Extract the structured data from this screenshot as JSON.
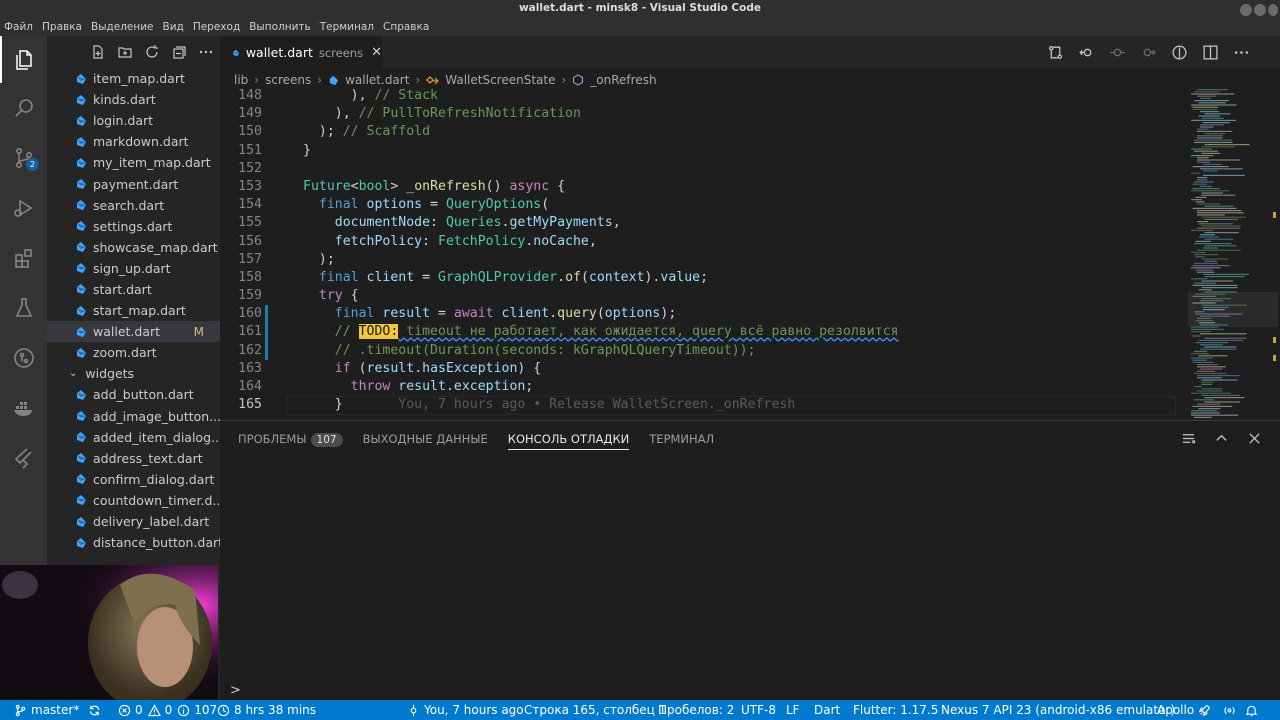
{
  "window": {
    "title": "wallet.dart - minsk8 - Visual Studio Code"
  },
  "menu": [
    "Файл",
    "Правка",
    "Выделение",
    "Вид",
    "Переход",
    "Выполнить",
    "Терминал",
    "Справка"
  ],
  "activity_bar": {
    "source_control_badge": "2"
  },
  "explorer": {
    "files_top": [
      {
        "name": "item_map.dart"
      },
      {
        "name": "kinds.dart"
      },
      {
        "name": "login.dart"
      },
      {
        "name": "markdown.dart"
      },
      {
        "name": "my_item_map.dart"
      },
      {
        "name": "payment.dart"
      },
      {
        "name": "search.dart"
      },
      {
        "name": "settings.dart"
      },
      {
        "name": "showcase_map.dart"
      },
      {
        "name": "sign_up.dart"
      },
      {
        "name": "start.dart"
      },
      {
        "name": "start_map.dart"
      },
      {
        "name": "wallet.dart",
        "selected": true,
        "status": "M"
      },
      {
        "name": "zoom.dart"
      }
    ],
    "folder": "widgets",
    "files_widgets": [
      {
        "name": "add_button.dart"
      },
      {
        "name": "add_image_button...."
      },
      {
        "name": "added_item_dialog...."
      },
      {
        "name": "address_text.dart"
      },
      {
        "name": "confirm_dialog.dart"
      },
      {
        "name": "countdown_timer.d..."
      },
      {
        "name": "delivery_label.dart"
      },
      {
        "name": "distance_button.dart"
      }
    ]
  },
  "editor": {
    "tab": {
      "name": "wallet.dart",
      "description": "screens"
    },
    "breadcrumbs": [
      "lib",
      "screens",
      "wallet.dart",
      "WalletScreenState",
      "_onRefresh"
    ],
    "lines": [
      {
        "n": "148",
        "html": "      ), <span class=\"cm\">// Stack</span>"
      },
      {
        "n": "149",
        "html": "    ), <span class=\"cm\">// PullToRefreshNotification</span>"
      },
      {
        "n": "150",
        "html": "  ); <span class=\"cm\">// Scaffold</span>"
      },
      {
        "n": "151",
        "html": "}"
      },
      {
        "n": "152",
        "html": ""
      },
      {
        "n": "153",
        "html": "<span class=\"ty\">Future</span>&lt;<span class=\"ty\">bool</span>&gt; <span class=\"fn\">_onRefresh</span>() <span class=\"kw2\">async</span> {"
      },
      {
        "n": "154",
        "html": "  <span class=\"kw\">final</span> <span class=\"var\">options</span> = <span class=\"ty\">QueryOptions</span>("
      },
      {
        "n": "155",
        "html": "    <span class=\"var\">documentNode</span>: <span class=\"ty\">Queries</span>.<span class=\"var\">getMyPayments</span>,"
      },
      {
        "n": "156",
        "html": "    <span class=\"var\">fetchPolicy</span>: <span class=\"ty\">FetchPolicy</span>.<span class=\"var\">noCache</span>,"
      },
      {
        "n": "157",
        "html": "  );"
      },
      {
        "n": "158",
        "html": "  <span class=\"kw\">final</span> <span class=\"var\">client</span> = <span class=\"ty\">GraphQLProvider</span>.<span class=\"fn\">of</span>(<span class=\"var\">context</span>).<span class=\"var\">value</span>;"
      },
      {
        "n": "159",
        "html": "  <span class=\"kw2\">try</span> {"
      },
      {
        "n": "160",
        "html": "    <span class=\"kw\">final</span> <span class=\"var\">result</span> = <span class=\"kw2\">await</span> <span class=\"var\">client</span>.<span class=\"fn\">query</span>(<span class=\"var\">options</span>);"
      },
      {
        "n": "161",
        "html": "    <span class=\"cm\">// </span><span class=\"todo\">TODO:</span><span class=\"cm squig\"> timeout не работает, как ожидается, query всё равно резолвится</span>"
      },
      {
        "n": "162",
        "html": "    <span class=\"cm\">// .timeout(Duration(seconds: kGraphQLQueryTimeout));</span>"
      },
      {
        "n": "163",
        "html": "    <span class=\"kw2\">if</span> (<span class=\"var\">result</span>.<span class=\"var\">hasException</span>) {"
      },
      {
        "n": "164",
        "html": "      <span class=\"kw2\">throw</span> <span class=\"var\">result</span>.<span class=\"var\">exception</span>;"
      },
      {
        "n": "165",
        "html": "    }       <span class=\"gh\">You, 7 hours ago • Release WalletScreen._onRefresh</span>"
      }
    ]
  },
  "panel": {
    "tabs": [
      {
        "label": "ПРОБЛЕМЫ",
        "badge": "107"
      },
      {
        "label": "ВЫХОДНЫЕ ДАННЫЕ"
      },
      {
        "label": "КОНСОЛЬ ОТЛАДКИ",
        "active": true
      },
      {
        "label": "ТЕРМИНАЛ"
      }
    ],
    "prompt": ">"
  },
  "statusbar": {
    "branch": "master*",
    "errors": "0",
    "warnings": "0",
    "infos": "107",
    "time_tracked": "8 hrs 38 mins",
    "blame": "You, 7 hours ago",
    "cursor": "Строка 165, столбец 1",
    "indent": "Пробелов: 2",
    "encoding": "UTF-8",
    "eol": "LF",
    "language": "Dart",
    "flutter": "Flutter: 1.17.5",
    "device": "Nexus 7 API 23 (android-x86 emulator)",
    "apollo": "Apollo"
  },
  "colors": {
    "statusbar": "#007acc",
    "todo_highlight": "#f2c744",
    "activity_badge": "#0e639c"
  }
}
